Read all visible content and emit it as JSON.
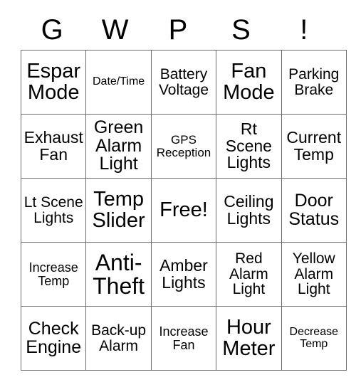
{
  "card": {
    "headers": [
      "G",
      "W",
      "P",
      "S",
      "!"
    ],
    "rows": [
      [
        {
          "label": "Espar Mode",
          "size": "sz-xl"
        },
        {
          "label": "Date/Time",
          "size": "sz-xs"
        },
        {
          "label": "Battery Voltage",
          "size": "sz-m"
        },
        {
          "label": "Fan Mode",
          "size": "sz-xl"
        },
        {
          "label": "Parking Brake",
          "size": "sz-m"
        }
      ],
      [
        {
          "label": "Exhaust Fan",
          "size": "sz-ml"
        },
        {
          "label": "Green Alarm Light",
          "size": "sz-l"
        },
        {
          "label": "GPS Reception",
          "size": "sz-s"
        },
        {
          "label": "Rt Scene Lights",
          "size": "sz-ml"
        },
        {
          "label": "Current Temp",
          "size": "sz-ml"
        }
      ],
      [
        {
          "label": "Lt Scene Lights",
          "size": "sz-m"
        },
        {
          "label": "Temp Slider",
          "size": "sz-xl"
        },
        {
          "label": "Free!",
          "size": "sz-xl"
        },
        {
          "label": "Ceiling Lights",
          "size": "sz-ml"
        },
        {
          "label": "Door Status",
          "size": "sz-l"
        }
      ],
      [
        {
          "label": "Increase Temp",
          "size": "sz-sm"
        },
        {
          "label": "Anti-Theft",
          "size": "sz-xxl"
        },
        {
          "label": "Amber Lights",
          "size": "sz-ml"
        },
        {
          "label": "Red Alarm Light",
          "size": "sz-m"
        },
        {
          "label": "Yellow Alarm Light",
          "size": "sz-m"
        }
      ],
      [
        {
          "label": "Check Engine",
          "size": "sz-l"
        },
        {
          "label": "Back-up Alarm",
          "size": "sz-m"
        },
        {
          "label": "Increase Fan",
          "size": "sz-sm"
        },
        {
          "label": "Hour Meter",
          "size": "sz-xl"
        },
        {
          "label": "Decrease Temp",
          "size": "sz-xs"
        }
      ]
    ]
  },
  "colors": {
    "background": "#ffffff",
    "text": "#000000",
    "grid_line": "#6b6b6b",
    "grid_border": "#4d4d4d"
  }
}
